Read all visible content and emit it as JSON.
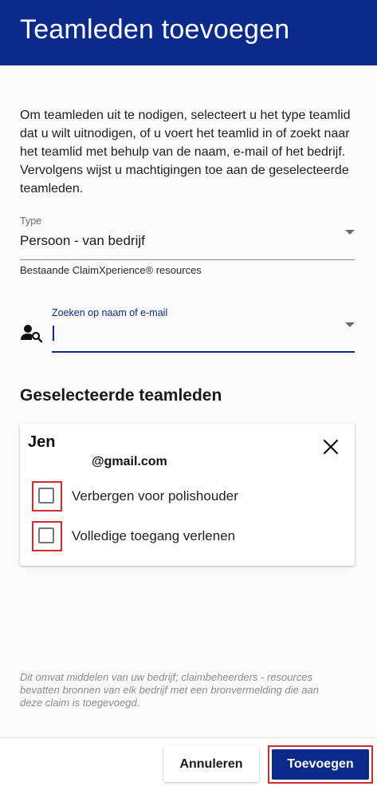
{
  "header": {
    "title": "Teamleden toevoegen"
  },
  "intro": {
    "text": "Om teamleden uit te nodigen, selecteert u het type teamlid dat u wilt uitnodigen, of u voert het teamlid in of zoekt naar het teamlid met behulp van de naam, e-mail of het bedrijf. Vervolgens wijst u machtigingen toe aan de geselecteerde teamleden."
  },
  "type_field": {
    "label": "Type",
    "value": "Persoon - van bedrijf"
  },
  "helper": {
    "text": "Bestaande ClaimXperience® resources"
  },
  "search": {
    "label": "Zoeken op naam of e-mail",
    "value": "",
    "placeholder": ""
  },
  "selected": {
    "title": "Geselecteerde teamleden",
    "member": {
      "name": "Jen",
      "email": "@gmail.com",
      "options": [
        {
          "label": "Verbergen voor polishouder",
          "checked": false
        },
        {
          "label": "Volledige toegang verlenen",
          "checked": false
        }
      ]
    }
  },
  "footnote": {
    "text": "Dit omvat middelen van uw bedrijf; claimbeheerders - resources bevatten bronnen van elk bedrijf met een bronvermelding die aan deze claim is toegevoegd."
  },
  "footer": {
    "cancel_label": "Annuleren",
    "add_label": "Toevoegen"
  },
  "icons": {
    "search": "person-search-icon",
    "close": "close-icon",
    "dropdown": "chevron-down-icon"
  },
  "colors": {
    "brand": "#0a2a8c",
    "highlight": "#d22c2c",
    "background": "#fafafa"
  }
}
